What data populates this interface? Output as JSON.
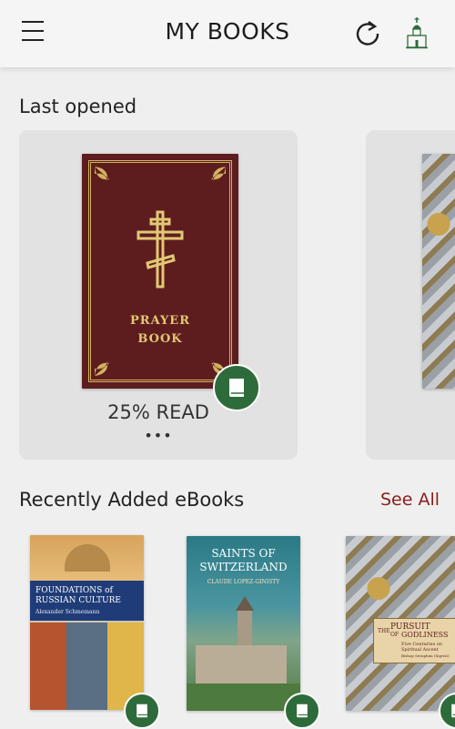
{
  "header": {
    "title": "MY BOOKS",
    "menu_icon": "menu-icon",
    "sync_icon": "sync-icon",
    "logo_icon": "church-logo-icon"
  },
  "last_opened": {
    "heading": "Last opened",
    "books": [
      {
        "cover_text_1": "PRAYER",
        "cover_text_2": "BOOK",
        "progress": "25% READ",
        "more": "•••"
      }
    ]
  },
  "recent": {
    "heading": "Recently Added eBooks",
    "see_all": "See All",
    "books": [
      {
        "title_1": "FOUNDATIONS of",
        "title_2": "RUSSIAN CULTURE",
        "author": "Alexander Schmemann"
      },
      {
        "title_1": "SAINTS OF",
        "title_2": "SWITZERLAND",
        "author": "CLAUDE LOPEZ-GINISTY"
      },
      {
        "title_1": "PURSUIT",
        "title_small": "THE",
        "title_of": "OF",
        "title_2": "GODLINESS",
        "subtitle": "Five Centuries on Spiritual Ascent",
        "author": "Bishop Seraphim (Sigrist)"
      }
    ]
  },
  "colors": {
    "accent": "#8c1c1c",
    "badge": "#2e6b3a",
    "background": "#efefef"
  }
}
